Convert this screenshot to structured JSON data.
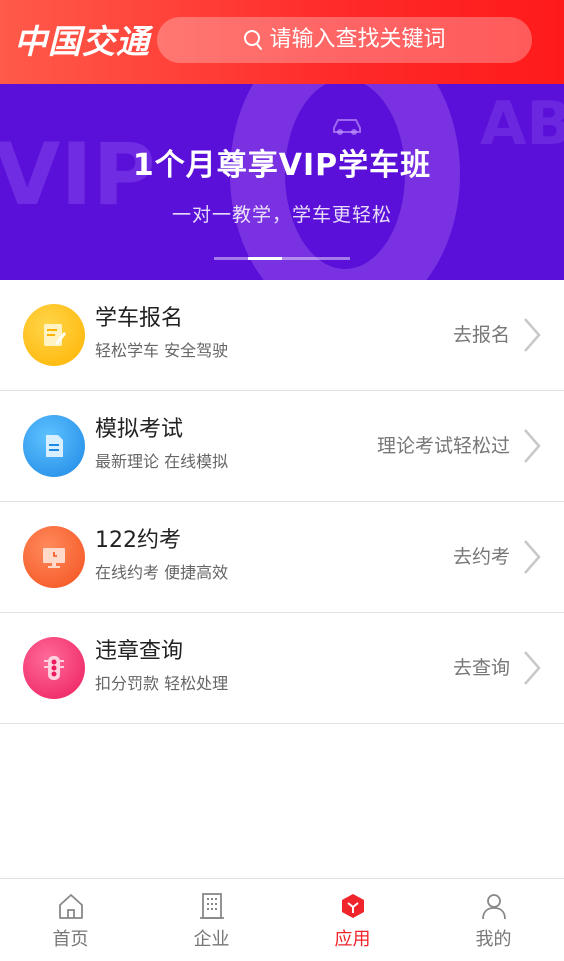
{
  "header": {
    "logo": "中国交通",
    "search_placeholder": "请输入查找关键词"
  },
  "banner": {
    "title": "1个月尊享VIP学车班",
    "subtitle": "一对一教学，学车更轻松",
    "deco_left": "VIP",
    "deco_right": "AB",
    "active_dot": 1,
    "dot_count": 4
  },
  "services": [
    {
      "title": "学车报名",
      "subtitle": "轻松学车 安全驾驶",
      "action": "去报名",
      "icon": "document-edit-icon",
      "color": "#ffbf1e"
    },
    {
      "title": "模拟考试",
      "subtitle": "最新理论 在线模拟",
      "action": "理论考试轻松过",
      "icon": "document-icon",
      "color": "#2ea3f5"
    },
    {
      "title": "122约考",
      "subtitle": "在线约考 便捷高效",
      "action": "去约考",
      "icon": "monitor-icon",
      "color": "#ff6a3d"
    },
    {
      "title": "违章查询",
      "subtitle": "扣分罚款 轻松处理",
      "action": "去查询",
      "icon": "traffic-light-icon",
      "color": "#ff3a6e"
    }
  ],
  "nav": {
    "home": "首页",
    "company": "企业",
    "apps": "应用",
    "mine": "我的",
    "active": "apps"
  },
  "colors": {
    "brand_red": "#ff2a2a",
    "banner_purple": "#5a10d8",
    "nav_active": "#f0242b"
  }
}
